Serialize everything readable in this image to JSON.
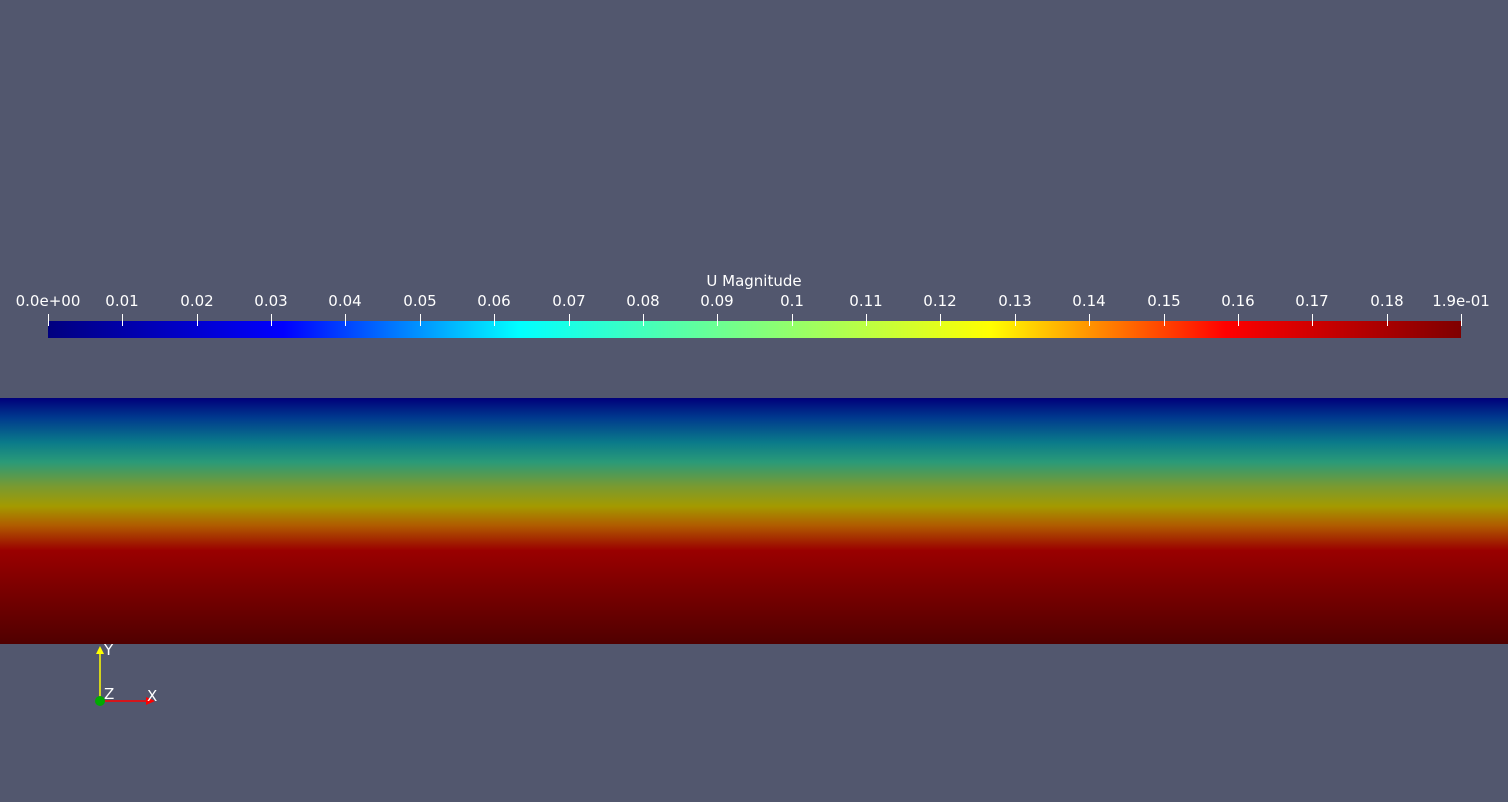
{
  "viewport": {
    "background_color": "#52576e"
  },
  "colorbar": {
    "title": "U Magnitude",
    "range": [
      0,
      0.19
    ],
    "colormap": "jet",
    "tick_labels": [
      "0.0e+00",
      "0.01",
      "0.02",
      "0.03",
      "0.04",
      "0.05",
      "0.06",
      "0.07",
      "0.08",
      "0.09",
      "0.1",
      "0.11",
      "0.12",
      "0.13",
      "0.14",
      "0.15",
      "0.16",
      "0.17",
      "0.18",
      "1.9e-01"
    ],
    "tick_values": [
      0,
      0.01,
      0.02,
      0.03,
      0.04,
      0.05,
      0.06,
      0.07,
      0.08,
      0.09,
      0.1,
      0.11,
      0.12,
      0.13,
      0.14,
      0.15,
      0.16,
      0.17,
      0.18,
      0.19
    ],
    "colors": [
      "#00007f",
      "#0000ff",
      "#00ffff",
      "#7fff7f",
      "#ffff00",
      "#ff0000",
      "#7f0000"
    ]
  },
  "field": {
    "top_value": 0.0,
    "bottom_value": 0.19
  },
  "orientation_axes": {
    "x_label": "X",
    "y_label": "Y",
    "z_label": "Z",
    "x_color": "#ff0000",
    "y_color": "#ffff00",
    "z_color": "#00aa00"
  }
}
